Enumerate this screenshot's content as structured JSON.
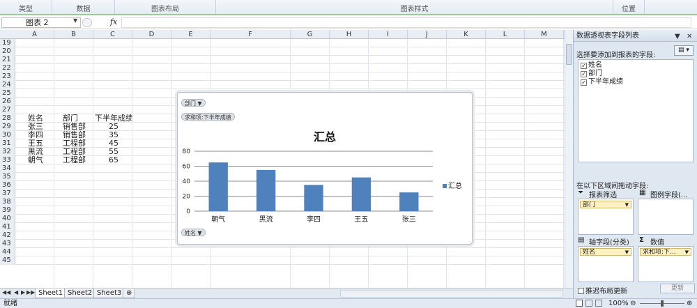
{
  "ribbon": {
    "groups": [
      "类型",
      "数据",
      "图表布局",
      "图表样式",
      "位置"
    ]
  },
  "formula_bar": {
    "name_box": "图表 2",
    "fx_label": "fx",
    "formula": ""
  },
  "grid": {
    "columns": [
      "A",
      "B",
      "C",
      "D",
      "E",
      "F",
      "G",
      "H",
      "I",
      "J",
      "K",
      "L",
      "M"
    ],
    "row_numbers": [
      "19",
      "20",
      "21",
      "22",
      "23",
      "24",
      "25",
      "26",
      "27",
      "28",
      "29",
      "30",
      "31",
      "32",
      "33",
      "34",
      "35",
      "36",
      "37",
      "38",
      "39",
      "40",
      "41",
      "42",
      "43",
      "44",
      "45"
    ],
    "table": {
      "headers": [
        "姓名",
        "部门",
        "下半年成绩"
      ],
      "rows": [
        [
          "张三",
          "销售部",
          "25"
        ],
        [
          "李四",
          "销售部",
          "35"
        ],
        [
          "王五",
          "工程部",
          "45"
        ],
        [
          "黑流",
          "工程部",
          "55"
        ],
        [
          "朝气",
          "工程部",
          "65"
        ]
      ]
    }
  },
  "chart": {
    "filter_button": "部门",
    "value_field_button": "求和项:下半年成绩",
    "axis_field_button": "姓名",
    "title": "汇总",
    "legend_label": "汇总",
    "series_color": "#4f81bd",
    "y_ticks": [
      "0",
      "20",
      "40",
      "60",
      "80"
    ]
  },
  "chart_data": {
    "type": "bar",
    "title": "汇总",
    "categories": [
      "朝气",
      "黑流",
      "李四",
      "王五",
      "张三"
    ],
    "series": [
      {
        "name": "汇总",
        "values": [
          65,
          55,
          35,
          45,
          25
        ]
      }
    ],
    "ylim": [
      0,
      80
    ],
    "grid": true,
    "legend": "right"
  },
  "sheets": {
    "tabs": [
      "Sheet1",
      "Sheet2",
      "Sheet3"
    ]
  },
  "status": {
    "ready": "就绪",
    "zoom": "100%"
  },
  "pivot_pane": {
    "title": "数据透视表字段列表",
    "choose_label": "选择要添加到报表的字段:",
    "fields": [
      "姓名",
      "部门",
      "下半年成绩"
    ],
    "drag_label": "在以下区域间拖动字段:",
    "zones": {
      "filter_label": "报表筛选",
      "legend_label": "图例字段(...",
      "axis_label": "轴字段(分类)",
      "values_label": "数值",
      "filter_tag": "部门",
      "axis_tag": "姓名",
      "values_tag": "求和项:下..."
    },
    "defer_label": "推迟布局更新",
    "update_button": "更新"
  }
}
